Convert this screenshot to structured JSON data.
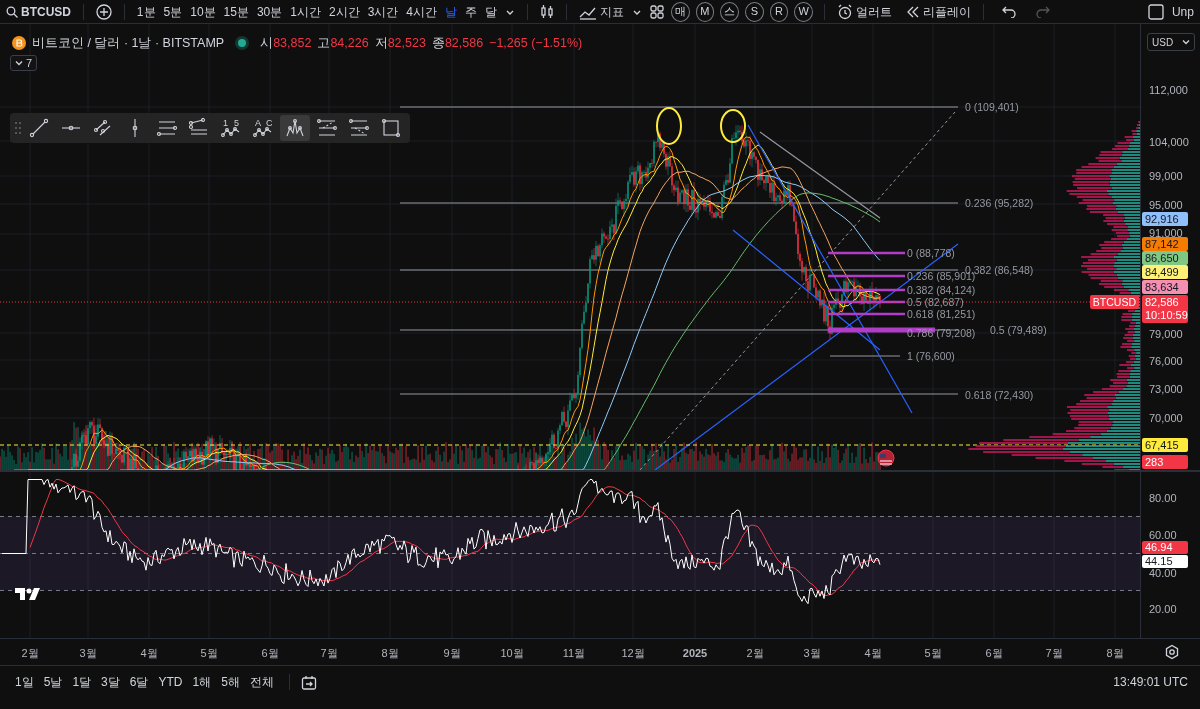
{
  "toolbar": {
    "symbol": "BTCUSD",
    "intervals": [
      {
        "label": "1분",
        "selected": false
      },
      {
        "label": "5분",
        "selected": false
      },
      {
        "label": "10분",
        "selected": false
      },
      {
        "label": "15분",
        "selected": false
      },
      {
        "label": "30분",
        "selected": false
      },
      {
        "label": "1시간",
        "selected": false
      },
      {
        "label": "2시간",
        "selected": false
      },
      {
        "label": "3시간",
        "selected": false
      },
      {
        "label": "4시간",
        "selected": false
      },
      {
        "label": "날",
        "selected": true
      },
      {
        "label": "주",
        "selected": false
      },
      {
        "label": "달",
        "selected": false
      }
    ],
    "indicators": "지표",
    "shortcuts": [
      "매",
      "M",
      "스",
      "S",
      "R",
      "W"
    ],
    "alert": "얼러트",
    "replay": "리플레이",
    "account": "Unp"
  },
  "legend": {
    "title": "비트코인 / 달러 · 1날 · BITSTAMP",
    "open_label": "시",
    "open": "83,852",
    "high_label": "고",
    "high": "84,226",
    "low_label": "저",
    "low": "82,523",
    "close_label": "종",
    "close": "82,586",
    "change": "−1,265 (−1.51%)",
    "indicator_count": "7",
    "currency": "USD"
  },
  "drawing_tools": [
    {
      "kind": "trend-line",
      "selected": false
    },
    {
      "kind": "horizontal-ray",
      "selected": false
    },
    {
      "kind": "parallel-channel",
      "selected": false
    },
    {
      "kind": "vertical-line",
      "selected": false
    },
    {
      "kind": "fib-levels",
      "selected": false
    },
    {
      "kind": "fib-extension",
      "selected": false
    },
    {
      "kind": "wave",
      "selected": false,
      "marks": [
        "1",
        "5"
      ]
    },
    {
      "kind": "wave",
      "selected": false,
      "marks": [
        "A",
        "C"
      ]
    },
    {
      "kind": "pattern",
      "selected": true
    },
    {
      "kind": "position-long",
      "selected": false
    },
    {
      "kind": "position-short",
      "selected": false
    },
    {
      "kind": "rectangle",
      "selected": false
    }
  ],
  "fib_labels": [
    "0 (109,401)",
    "0.236 (95,282)",
    "0.382 (86,548)",
    "0 (88,778)",
    "0.236 (85,901)",
    "0.382 (84,124)",
    "0.5 (82,687)",
    "0.618 (81,251)",
    "0.786 (79,208)",
    "0.5 (79,489)",
    "1 (76,600)",
    "0.618 (72,430)"
  ],
  "price_axis": {
    "ticks": [
      "112,000",
      "104,000",
      "99,000",
      "95,000",
      "91,000",
      "79,000",
      "76,000",
      "73,000",
      "70,000"
    ],
    "markers": [
      {
        "value": "92,916",
        "color": "#90bff9"
      },
      {
        "value": "87,142",
        "color": "#f57c00"
      },
      {
        "value": "86,650",
        "color": "#81c784"
      },
      {
        "value": "84,499",
        "color": "#fff176"
      },
      {
        "value": "83,634",
        "color": "#f48fb1"
      },
      {
        "value": "67,415",
        "color": "#ffeb3b"
      },
      {
        "value": "283",
        "color": "#f23645"
      }
    ],
    "symbol_tag": "BTCUSD",
    "last_price": "82,586",
    "countdown": "10:10:59"
  },
  "rsi_axis": {
    "ticks": [
      "80.00",
      "60.00",
      "40.00",
      "20.00"
    ],
    "markers": [
      {
        "value": "46.94",
        "color": "#f23645"
      },
      {
        "value": "44.15",
        "color": "#ffffff"
      }
    ]
  },
  "time_axis": [
    "2월",
    "3월",
    "4월",
    "5월",
    "6월",
    "7월",
    "8월",
    "9월",
    "10월",
    "11월",
    "12월",
    "2025",
    "2월",
    "3월",
    "4월",
    "5월",
    "6월",
    "7월",
    "8월"
  ],
  "ranges": [
    "1일",
    "5날",
    "1달",
    "3달",
    "6달",
    "YTD",
    "1해",
    "5해",
    "전체"
  ],
  "clock": "13:49:01 UTC"
}
